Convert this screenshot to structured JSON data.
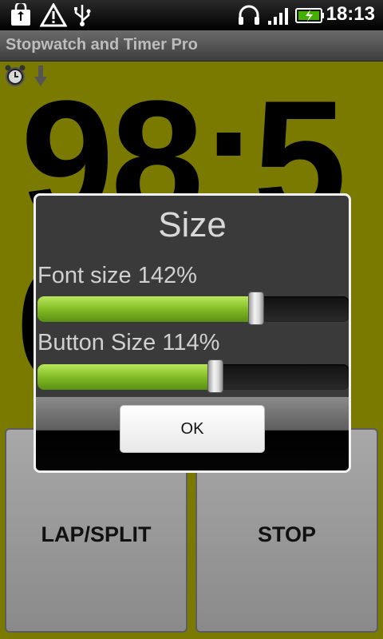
{
  "status_bar": {
    "time": "18:13",
    "icons": [
      "shopping-bag-icon",
      "warning-icon",
      "usb-icon",
      "headphones-icon",
      "signal-icon",
      "battery-charging-icon"
    ]
  },
  "app": {
    "title": "Stopwatch and Timer Pro",
    "indicator_icons": [
      "alarm-clock-icon",
      "arrow-down-icon"
    ]
  },
  "timer_display": {
    "line1": "98:5",
    "line2": "6"
  },
  "buttons": {
    "lap_split": "LAP/SPLIT",
    "stop": "STOP"
  },
  "dialog": {
    "title": "Size",
    "font_size_label": "Font size 142%",
    "font_size_value": 0.7,
    "button_size_label": "Button Size 114%",
    "button_size_value": 0.57,
    "ok_label": "OK"
  },
  "colors": {
    "background": "#7a7a00",
    "slider_fill": "#7fb722"
  }
}
